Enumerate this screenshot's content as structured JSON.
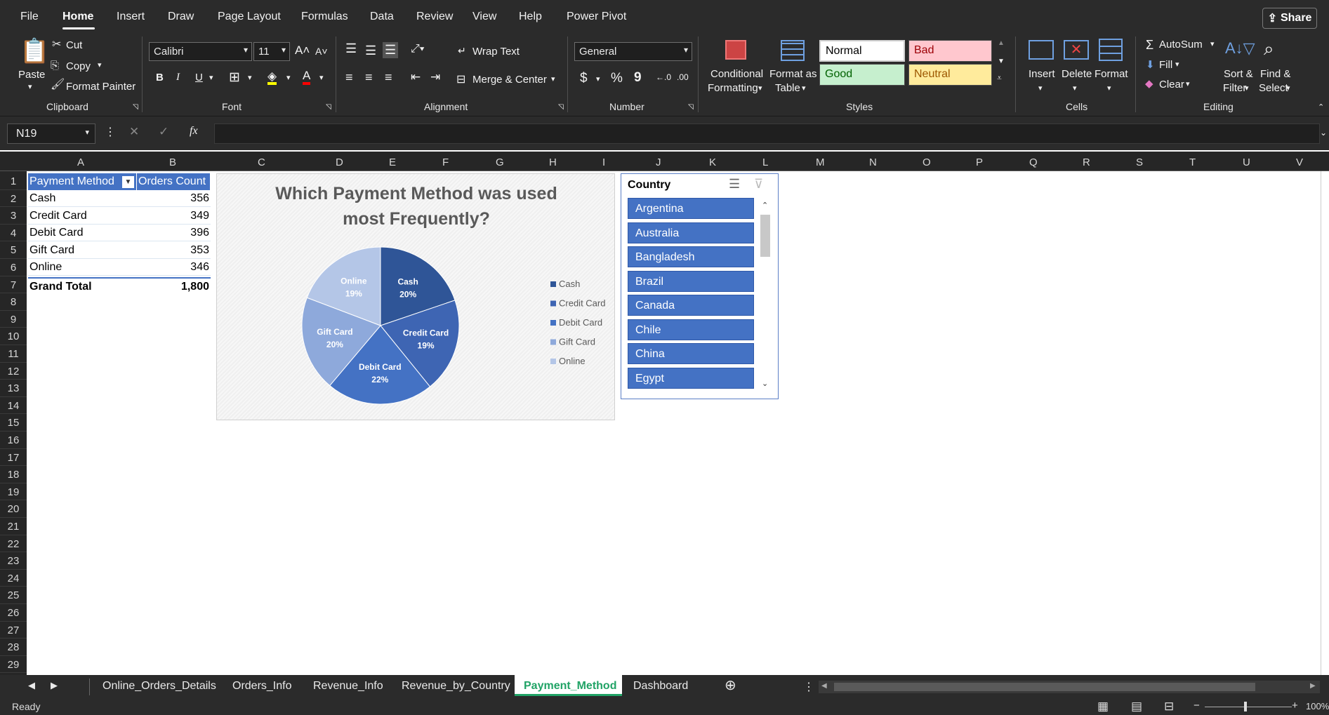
{
  "menu": {
    "tabs": [
      "File",
      "Home",
      "Insert",
      "Draw",
      "Page Layout",
      "Formulas",
      "Data",
      "Review",
      "View",
      "Help",
      "Power Pivot"
    ],
    "active": "Home",
    "share_label": "Share"
  },
  "ribbon": {
    "clipboard": {
      "paste": "Paste",
      "cut": "Cut",
      "copy": "Copy",
      "format_painter": "Format Painter",
      "label": "Clipboard"
    },
    "font": {
      "name": "Calibri",
      "size": "11",
      "bold": "B",
      "italic": "I",
      "underline": "U",
      "label": "Font"
    },
    "alignment": {
      "wrap_text": "Wrap Text",
      "merge_center": "Merge & Center",
      "label": "Alignment"
    },
    "number": {
      "format": "General",
      "currency": "$",
      "percent": "%",
      "comma": "9",
      "label": "Number"
    },
    "styles": {
      "conditional": "Conditional",
      "conditional2": "Formatting",
      "format_table": "Format as",
      "format_table2": "Table",
      "normal": "Normal",
      "bad": "Bad",
      "good": "Good",
      "neutral": "Neutral",
      "label": "Styles"
    },
    "cells": {
      "insert": "Insert",
      "delete": "Delete",
      "format": "Format",
      "label": "Cells"
    },
    "editing": {
      "autosum": "AutoSum",
      "fill": "Fill",
      "clear": "Clear",
      "sort": "Sort &",
      "sort2": "Filter",
      "find": "Find &",
      "find2": "Select",
      "label": "Editing"
    }
  },
  "formula_bar": {
    "name_box": "N19",
    "fx": "fx",
    "value": ""
  },
  "columns": [
    "A",
    "B",
    "C",
    "D",
    "E",
    "F",
    "G",
    "H",
    "I",
    "J",
    "K",
    "L",
    "M",
    "N",
    "O",
    "P",
    "Q",
    "R",
    "S",
    "T",
    "U",
    "V"
  ],
  "rows": [
    "1",
    "2",
    "3",
    "4",
    "5",
    "6",
    "7",
    "8",
    "9",
    "10",
    "11",
    "12",
    "13",
    "14",
    "15",
    "16",
    "17",
    "18",
    "19",
    "20",
    "21",
    "22",
    "23",
    "24",
    "25",
    "26",
    "27",
    "28",
    "29"
  ],
  "pivot": {
    "header_method": "Payment Method",
    "header_count": "Orders Count",
    "rows": [
      {
        "method": "Cash",
        "count": "356"
      },
      {
        "method": "Credit Card",
        "count": "349"
      },
      {
        "method": "Debit Card",
        "count": "396"
      },
      {
        "method": "Gift Card",
        "count": "353"
      },
      {
        "method": "Online",
        "count": "346"
      }
    ],
    "total_label": "Grand Total",
    "total_value": "1,800"
  },
  "chart_data": {
    "type": "pie",
    "title": "Which Payment Method was used most Frequently?",
    "categories": [
      "Cash",
      "Credit Card",
      "Debit Card",
      "Gift Card",
      "Online"
    ],
    "values": [
      356,
      349,
      396,
      353,
      346
    ],
    "data_labels": [
      "20%",
      "19%",
      "22%",
      "20%",
      "19%"
    ],
    "colors": [
      "#2f5597",
      "#3e65b3",
      "#4472c4",
      "#8ea9db",
      "#b4c6e7"
    ],
    "legend_position": "right"
  },
  "slicer": {
    "title": "Country",
    "items": [
      "Argentina",
      "Australia",
      "Bangladesh",
      "Brazil",
      "Canada",
      "Chile",
      "China",
      "Egypt"
    ]
  },
  "sheets": {
    "tabs": [
      "Online_Orders_Details",
      "Orders_Info",
      "Revenue_Info",
      "Revenue_by_Country",
      "Payment_Method",
      "Dashboard"
    ],
    "active": "Payment_Method"
  },
  "status": {
    "ready": "Ready",
    "zoom": "100%"
  }
}
